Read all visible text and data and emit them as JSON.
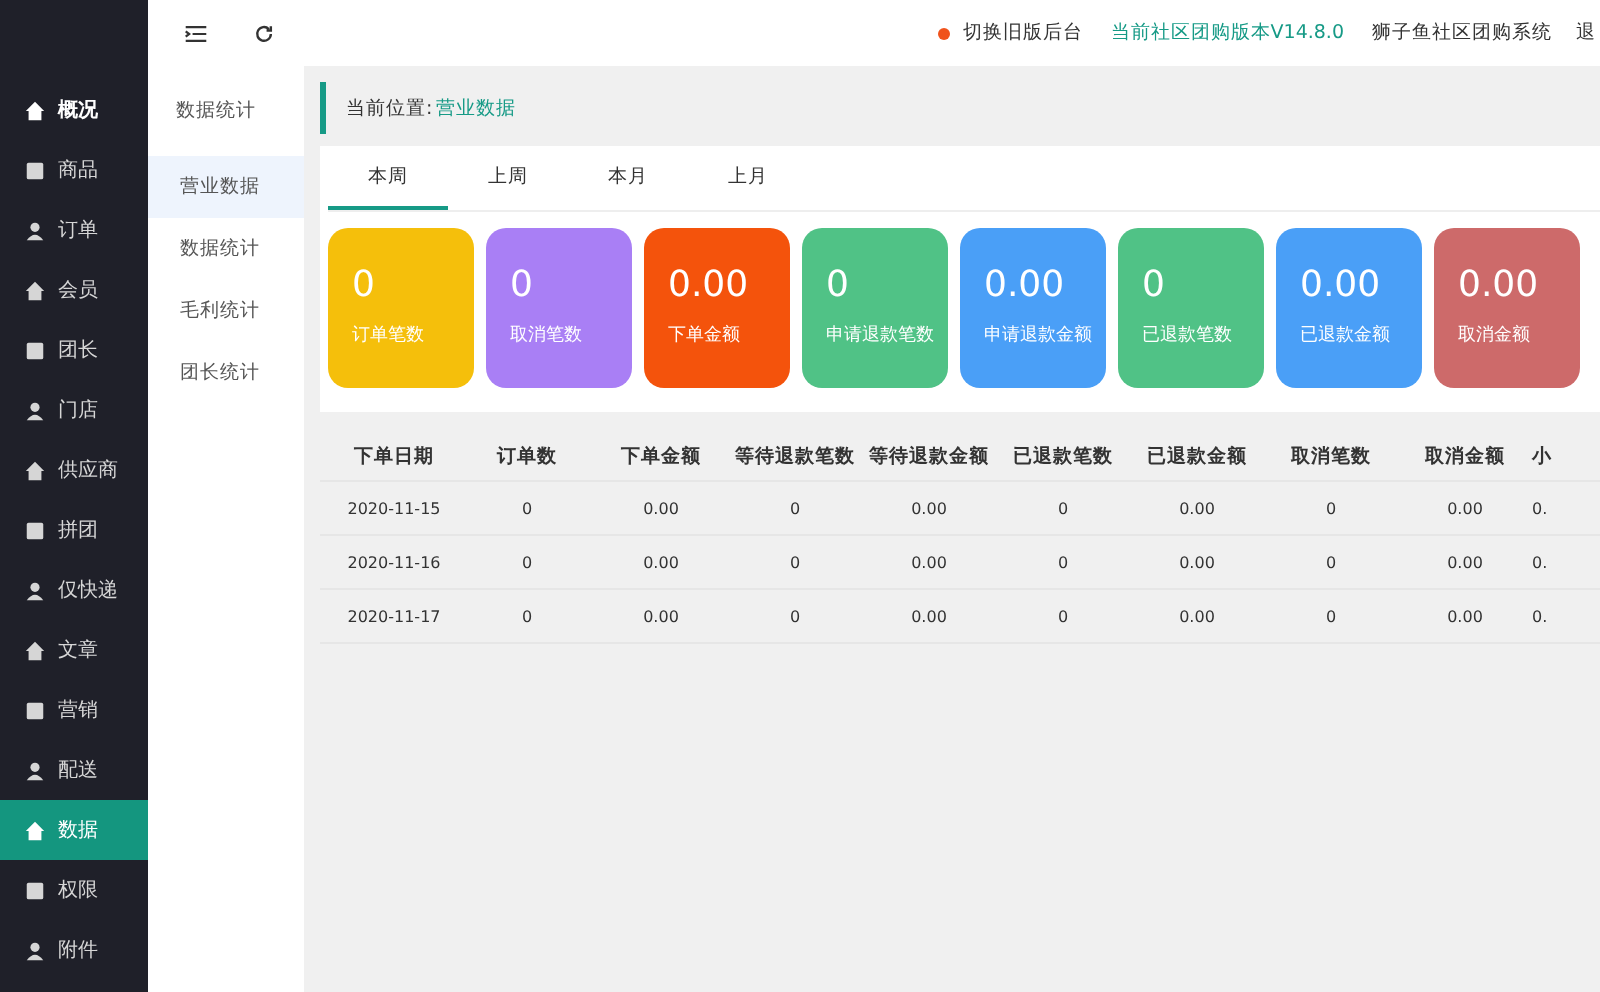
{
  "sidebar": {
    "items": [
      {
        "label": "概况",
        "selected": false
      },
      {
        "label": "商品",
        "selected": false
      },
      {
        "label": "订单",
        "selected": false
      },
      {
        "label": "会员",
        "selected": false
      },
      {
        "label": "团长",
        "selected": false
      },
      {
        "label": "门店",
        "selected": false
      },
      {
        "label": "供应商",
        "selected": false
      },
      {
        "label": "拼团",
        "selected": false
      },
      {
        "label": "仅快递",
        "selected": false
      },
      {
        "label": "文章",
        "selected": false
      },
      {
        "label": "营销",
        "selected": false
      },
      {
        "label": "配送",
        "selected": false
      },
      {
        "label": "数据",
        "selected": true
      },
      {
        "label": "权限",
        "selected": false
      },
      {
        "label": "附件",
        "selected": false
      }
    ]
  },
  "subnav": {
    "title": "数据统计",
    "items": [
      {
        "label": "营业数据",
        "selected": true
      },
      {
        "label": "数据统计",
        "selected": false
      },
      {
        "label": "毛利统计",
        "selected": false
      },
      {
        "label": "团长统计",
        "selected": false
      }
    ]
  },
  "header": {
    "switch_link": "切换旧版后台",
    "version": "当前社区团购版本V14.8.0",
    "system_name": "狮子鱼社区团购系统",
    "logout": "退"
  },
  "breadcrumb": {
    "label": "当前位置:",
    "current": "营业数据"
  },
  "tabs": [
    {
      "label": "本周",
      "selected": true
    },
    {
      "label": "上周",
      "selected": false
    },
    {
      "label": "本月",
      "selected": false
    },
    {
      "label": "上月",
      "selected": false
    }
  ],
  "stats": [
    {
      "value": "0",
      "label": "订单笔数",
      "color": "#f5bf0b"
    },
    {
      "value": "0",
      "label": "取消笔数",
      "color": "#a97ff5"
    },
    {
      "value": "0.00",
      "label": "下单金额",
      "color": "#f4530c"
    },
    {
      "value": "0",
      "label": "申请退款笔数",
      "color": "#50c286"
    },
    {
      "value": "0.00",
      "label": "申请退款金额",
      "color": "#4a9ff7"
    },
    {
      "value": "0",
      "label": "已退款笔数",
      "color": "#50c286"
    },
    {
      "value": "0.00",
      "label": "已退款金额",
      "color": "#4a9ff7"
    },
    {
      "value": "0.00",
      "label": "取消金额",
      "color": "#cd6a6a"
    }
  ],
  "table": {
    "columns": [
      "下单日期",
      "订单数",
      "下单金额",
      "等待退款笔数",
      "等待退款金额",
      "已退款笔数",
      "已退款金额",
      "取消笔数",
      "取消金额",
      "小"
    ],
    "rows": [
      [
        "2020-11-15",
        "0",
        "0.00",
        "0",
        "0.00",
        "0",
        "0.00",
        "0",
        "0.00",
        "0."
      ],
      [
        "2020-11-16",
        "0",
        "0.00",
        "0",
        "0.00",
        "0",
        "0.00",
        "0",
        "0.00",
        "0."
      ],
      [
        "2020-11-17",
        "0",
        "0.00",
        "0",
        "0.00",
        "0",
        "0.00",
        "0",
        "0.00",
        "0."
      ]
    ]
  }
}
